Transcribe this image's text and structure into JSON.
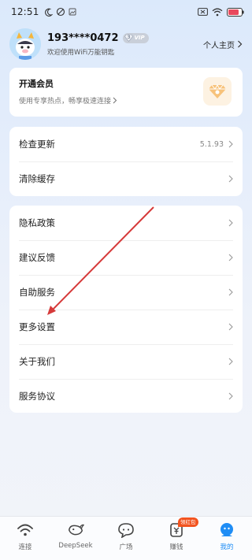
{
  "status_bar": {
    "time": "12:51",
    "left_icons": [
      "moon-icon",
      "data-saver-icon",
      "image-notification-icon"
    ],
    "right_icons": [
      "battery-saver-icon",
      "wifi-icon",
      "battery-icon"
    ],
    "battery_label": "80"
  },
  "profile": {
    "phone": "193****0472",
    "vip_level": "3",
    "vip_label": "VIP",
    "welcome": "欢迎使用WiFi万能钥匙",
    "homepage_label": "个人主页"
  },
  "member_card": {
    "title": "开通会员",
    "subtitle": "使用专享热点，畅享极速连接"
  },
  "update_card": {
    "rows": [
      {
        "label": "检查更新",
        "value": "5.1.93"
      },
      {
        "label": "清除缓存",
        "value": ""
      }
    ]
  },
  "menu_card": {
    "rows": [
      {
        "label": "隐私政策"
      },
      {
        "label": "建议反馈"
      },
      {
        "label": "自助服务"
      },
      {
        "label": "更多设置"
      },
      {
        "label": "关于我们"
      },
      {
        "label": "服务协议"
      }
    ]
  },
  "bottom_nav": {
    "items": [
      {
        "label": "连接",
        "icon": "wifi-icon"
      },
      {
        "label": "DeepSeek",
        "icon": "whale-icon"
      },
      {
        "label": "广场",
        "icon": "chat-bubble-icon"
      },
      {
        "label": "赚钱",
        "icon": "money-icon",
        "badge": "领红包"
      },
      {
        "label": "我的",
        "icon": "profile-icon",
        "active": true
      }
    ]
  },
  "colors": {
    "accent": "#1f8df5",
    "annotation_arrow": "#d63a3a",
    "badge": "#f2531f"
  }
}
